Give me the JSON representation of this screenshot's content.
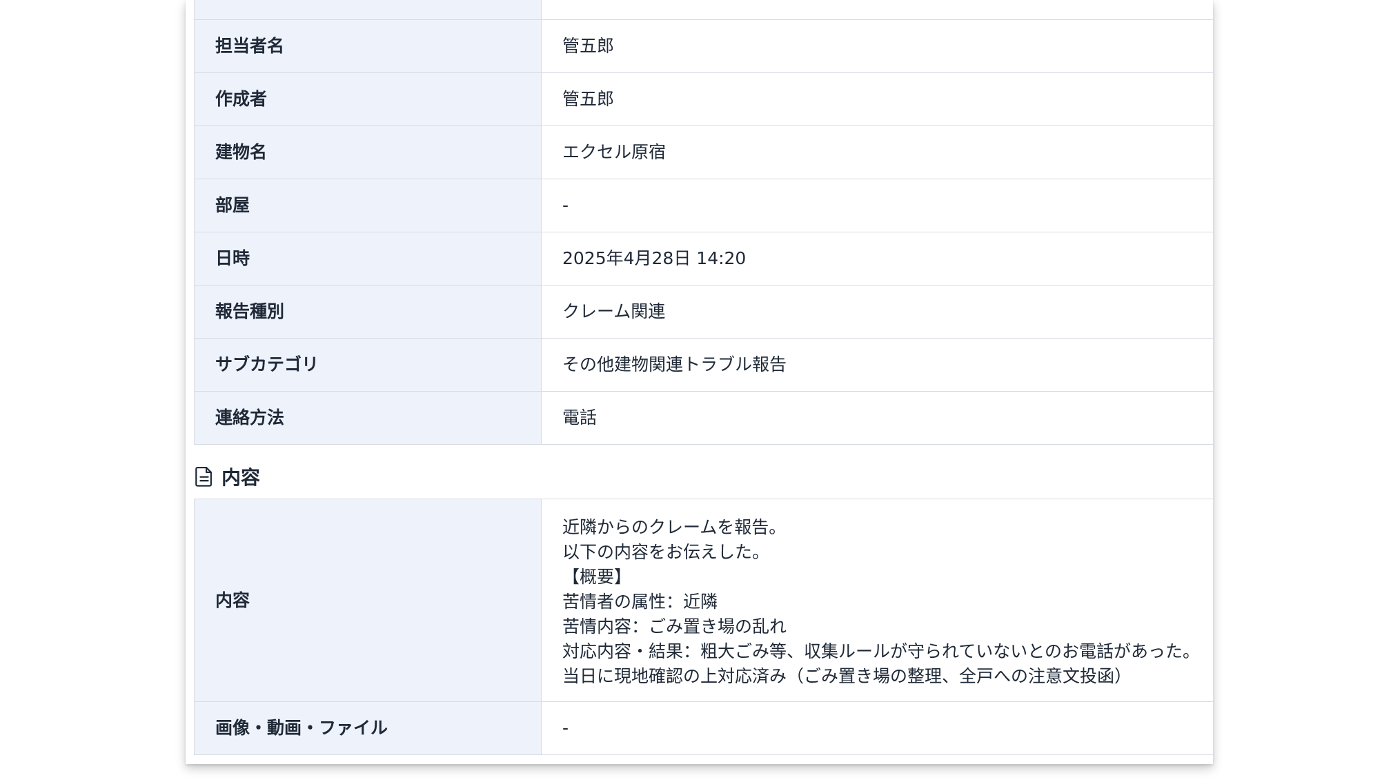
{
  "details": {
    "rows": [
      {
        "label": "担当者名",
        "value": "管五郎"
      },
      {
        "label": "作成者",
        "value": "管五郎"
      },
      {
        "label": "建物名",
        "value": "エクセル原宿"
      },
      {
        "label": "部屋",
        "value": "-"
      },
      {
        "label": "日時",
        "value": "2025年4月28日 14:20"
      },
      {
        "label": "報告種別",
        "value": "クレーム関連"
      },
      {
        "label": "サブカテゴリ",
        "value": "その他建物関連トラブル報告"
      },
      {
        "label": "連絡方法",
        "value": "電話"
      }
    ]
  },
  "content_section": {
    "title": "内容",
    "content_label": "内容",
    "content_lines": [
      "近隣からのクレームを報告。",
      "以下の内容をお伝えした。",
      "【概要】",
      "苦情者の属性：近隣",
      "苦情内容：ごみ置き場の乱れ",
      "対応内容・結果：粗大ごみ等、収集ルールが守られていないとのお電話があった。",
      "当日に現地確認の上対応済み（ごみ置き場の整理、全戸への注意文投函）"
    ],
    "attachments_label": "画像・動画・ファイル",
    "attachments_value": "-"
  }
}
